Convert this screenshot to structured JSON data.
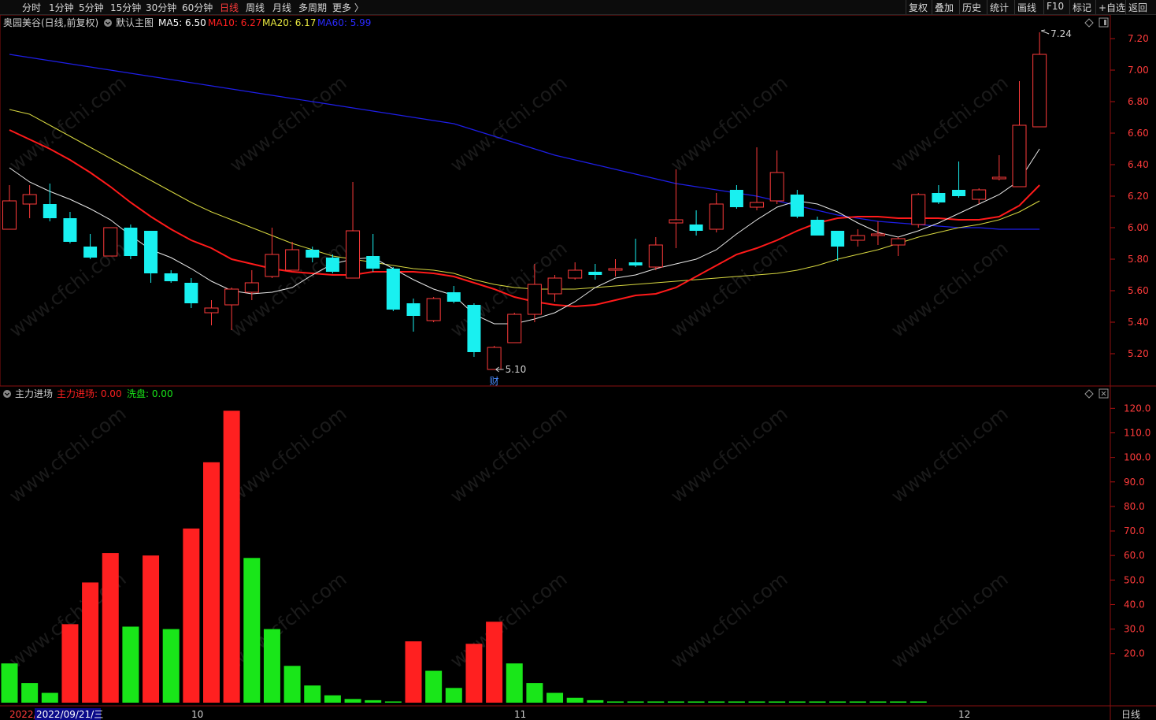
{
  "toolbar": {
    "periods": [
      "分时",
      "1分钟",
      "5分钟",
      "15分钟",
      "30分钟",
      "60分钟",
      "日线",
      "周线",
      "月线",
      "多周期",
      "更多 〉"
    ],
    "active_period": "日线",
    "right": [
      "复权",
      "叠加",
      "历史",
      "统计",
      "画线",
      "F10",
      "标记",
      "+自选",
      "返回"
    ]
  },
  "main_panel": {
    "stock_label": "奥园美谷(日线,前复权)",
    "template_label": "默认主图",
    "ma": [
      {
        "label": "MA5: 6.50",
        "color": "#ffffff"
      },
      {
        "label": "MA10: 6.27",
        "color": "#ff2020"
      },
      {
        "label": "MA20: 6.17",
        "color": "#e8e840"
      },
      {
        "label": "MA60: 5.99",
        "color": "#2a2aff"
      }
    ],
    "high_label": "7.24",
    "low_label": "5.10",
    "fin_marker": "财"
  },
  "sub_panel": {
    "title": "主力进场",
    "main_force_label": "主力进场: 0.00",
    "wash_label": "洗盘: 0.00",
    "main_force_color": "#ff2020",
    "wash_color": "#19e619"
  },
  "bottom_axis": {
    "first_date": "2022/",
    "cursor_date": "2022/09/21/三",
    "months": [
      "10",
      "11",
      "12"
    ],
    "period_label": "日线"
  },
  "chart_data": [
    {
      "type": "candlestick",
      "price_axis_ticks": [
        5.2,
        5.4,
        5.6,
        5.8,
        6.0,
        6.2,
        6.4,
        6.6,
        6.8,
        7.0,
        7.2
      ],
      "ylim": [
        5.0,
        7.3
      ],
      "candles": [
        {
          "o": 5.99,
          "h": 6.27,
          "l": 5.99,
          "c": 6.17
        },
        {
          "o": 6.15,
          "h": 6.27,
          "l": 6.06,
          "c": 6.21
        },
        {
          "o": 6.15,
          "h": 6.28,
          "l": 6.04,
          "c": 6.06
        },
        {
          "o": 6.06,
          "h": 6.1,
          "l": 5.9,
          "c": 5.91
        },
        {
          "o": 5.88,
          "h": 5.96,
          "l": 5.8,
          "c": 5.81
        },
        {
          "o": 5.82,
          "h": 6.0,
          "l": 5.82,
          "c": 6.0
        },
        {
          "o": 6.0,
          "h": 6.02,
          "l": 5.8,
          "c": 5.82
        },
        {
          "o": 5.98,
          "h": 5.98,
          "l": 5.65,
          "c": 5.71
        },
        {
          "o": 5.71,
          "h": 5.73,
          "l": 5.65,
          "c": 5.66
        },
        {
          "o": 5.65,
          "h": 5.68,
          "l": 5.49,
          "c": 5.52
        },
        {
          "o": 5.46,
          "h": 5.54,
          "l": 5.38,
          "c": 5.49
        },
        {
          "o": 5.51,
          "h": 5.62,
          "l": 5.35,
          "c": 5.61
        },
        {
          "o": 5.59,
          "h": 5.73,
          "l": 5.54,
          "c": 5.65
        },
        {
          "o": 5.69,
          "h": 6.0,
          "l": 5.68,
          "c": 5.83
        },
        {
          "o": 5.73,
          "h": 5.91,
          "l": 5.73,
          "c": 5.86
        },
        {
          "o": 5.86,
          "h": 5.88,
          "l": 5.78,
          "c": 5.81
        },
        {
          "o": 5.81,
          "h": 5.83,
          "l": 5.71,
          "c": 5.72
        },
        {
          "o": 5.68,
          "h": 6.29,
          "l": 5.68,
          "c": 5.98
        },
        {
          "o": 5.82,
          "h": 5.96,
          "l": 5.72,
          "c": 5.74
        },
        {
          "o": 5.74,
          "h": 5.75,
          "l": 5.47,
          "c": 5.48
        },
        {
          "o": 5.52,
          "h": 5.55,
          "l": 5.34,
          "c": 5.44
        },
        {
          "o": 5.41,
          "h": 5.56,
          "l": 5.4,
          "c": 5.55
        },
        {
          "o": 5.59,
          "h": 5.63,
          "l": 5.52,
          "c": 5.53
        },
        {
          "o": 5.51,
          "h": 5.52,
          "l": 5.18,
          "c": 5.21
        },
        {
          "o": 5.1,
          "h": 5.25,
          "l": 5.1,
          "c": 5.24
        },
        {
          "o": 5.27,
          "h": 5.46,
          "l": 5.27,
          "c": 5.45
        },
        {
          "o": 5.45,
          "h": 5.77,
          "l": 5.4,
          "c": 5.64
        },
        {
          "o": 5.58,
          "h": 5.7,
          "l": 5.53,
          "c": 5.68
        },
        {
          "o": 5.68,
          "h": 5.78,
          "l": 5.67,
          "c": 5.73
        },
        {
          "o": 5.72,
          "h": 5.77,
          "l": 5.67,
          "c": 5.7
        },
        {
          "o": 5.73,
          "h": 5.8,
          "l": 5.69,
          "c": 5.74
        },
        {
          "o": 5.78,
          "h": 5.93,
          "l": 5.75,
          "c": 5.76
        },
        {
          "o": 5.75,
          "h": 5.94,
          "l": 5.73,
          "c": 5.89
        },
        {
          "o": 6.03,
          "h": 6.37,
          "l": 5.87,
          "c": 6.05
        },
        {
          "o": 6.02,
          "h": 6.11,
          "l": 5.95,
          "c": 5.98
        },
        {
          "o": 5.99,
          "h": 6.22,
          "l": 5.97,
          "c": 6.15
        },
        {
          "o": 6.24,
          "h": 6.27,
          "l": 6.12,
          "c": 6.13
        },
        {
          "o": 6.13,
          "h": 6.51,
          "l": 6.11,
          "c": 6.16
        },
        {
          "o": 6.17,
          "h": 6.49,
          "l": 6.15,
          "c": 6.35
        },
        {
          "o": 6.21,
          "h": 6.24,
          "l": 6.06,
          "c": 6.07
        },
        {
          "o": 6.05,
          "h": 6.07,
          "l": 5.95,
          "c": 5.95
        },
        {
          "o": 5.98,
          "h": 5.98,
          "l": 5.79,
          "c": 5.88
        },
        {
          "o": 5.92,
          "h": 5.99,
          "l": 5.88,
          "c": 5.95
        },
        {
          "o": 5.95,
          "h": 6.04,
          "l": 5.89,
          "c": 5.96
        },
        {
          "o": 5.89,
          "h": 5.94,
          "l": 5.82,
          "c": 5.93
        },
        {
          "o": 6.02,
          "h": 6.22,
          "l": 6.0,
          "c": 6.21
        },
        {
          "o": 6.22,
          "h": 6.27,
          "l": 6.15,
          "c": 6.16
        },
        {
          "o": 6.24,
          "h": 6.42,
          "l": 6.19,
          "c": 6.2
        },
        {
          "o": 6.18,
          "h": 6.25,
          "l": 6.15,
          "c": 6.24
        },
        {
          "o": 6.31,
          "h": 6.46,
          "l": 6.3,
          "c": 6.32
        },
        {
          "o": 6.26,
          "h": 6.93,
          "l": 6.26,
          "c": 6.65
        },
        {
          "o": 6.64,
          "h": 7.24,
          "l": 6.64,
          "c": 7.1
        }
      ],
      "ma5": [
        6.38,
        6.29,
        6.23,
        6.18,
        6.12,
        6.05,
        5.95,
        5.86,
        5.81,
        5.74,
        5.66,
        5.6,
        5.58,
        5.59,
        5.62,
        5.7,
        5.77,
        5.8,
        5.81,
        5.74,
        5.67,
        5.61,
        5.57,
        5.45,
        5.39,
        5.39,
        5.42,
        5.46,
        5.53,
        5.62,
        5.68,
        5.7,
        5.74,
        5.77,
        5.8,
        5.86,
        5.96,
        6.05,
        6.13,
        6.17,
        6.15,
        6.1,
        6.03,
        5.97,
        5.94,
        5.98,
        6.03,
        6.09,
        6.15,
        6.21,
        6.3,
        6.5
      ],
      "ma10": [
        6.62,
        6.56,
        6.5,
        6.43,
        6.35,
        6.26,
        6.16,
        6.07,
        5.99,
        5.92,
        5.87,
        5.8,
        5.77,
        5.74,
        5.72,
        5.71,
        5.7,
        5.7,
        5.72,
        5.72,
        5.72,
        5.71,
        5.69,
        5.65,
        5.61,
        5.56,
        5.53,
        5.51,
        5.5,
        5.51,
        5.54,
        5.57,
        5.58,
        5.62,
        5.69,
        5.76,
        5.83,
        5.87,
        5.92,
        5.98,
        6.03,
        6.06,
        6.07,
        6.07,
        6.06,
        6.06,
        6.06,
        6.05,
        6.05,
        6.07,
        6.14,
        6.27
      ],
      "ma20": [
        6.75,
        6.72,
        6.65,
        6.58,
        6.51,
        6.44,
        6.37,
        6.3,
        6.23,
        6.16,
        6.1,
        6.05,
        6.0,
        5.95,
        5.9,
        5.86,
        5.82,
        5.8,
        5.78,
        5.76,
        5.74,
        5.73,
        5.71,
        5.67,
        5.64,
        5.62,
        5.61,
        5.61,
        5.61,
        5.62,
        5.63,
        5.64,
        5.65,
        5.66,
        5.67,
        5.68,
        5.69,
        5.7,
        5.71,
        5.73,
        5.76,
        5.8,
        5.83,
        5.86,
        5.9,
        5.94,
        5.97,
        6.0,
        6.02,
        6.05,
        6.1,
        6.17
      ],
      "ma60": [
        7.1,
        7.08,
        7.06,
        7.04,
        7.02,
        7.0,
        6.98,
        6.96,
        6.94,
        6.92,
        6.9,
        6.88,
        6.86,
        6.84,
        6.82,
        6.8,
        6.78,
        6.76,
        6.74,
        6.72,
        6.7,
        6.68,
        6.66,
        6.62,
        6.58,
        6.54,
        6.5,
        6.46,
        6.43,
        6.4,
        6.37,
        6.34,
        6.31,
        6.28,
        6.26,
        6.24,
        6.22,
        6.2,
        6.17,
        6.14,
        6.11,
        6.08,
        6.06,
        6.04,
        6.03,
        6.02,
        6.01,
        6.0,
        6.0,
        5.99,
        5.99,
        5.99
      ]
    },
    {
      "type": "bar",
      "title": "主力进场",
      "value_axis_ticks": [
        20,
        30,
        40,
        50,
        60,
        70,
        80,
        90,
        100,
        110,
        120
      ],
      "ylim": [
        0,
        123
      ],
      "series": [
        {
          "name": "主力进场",
          "color": "#ff2020",
          "values": [
            0,
            0,
            0,
            32,
            49,
            61,
            0,
            60,
            0,
            71,
            98,
            119,
            0,
            0,
            0,
            0,
            0,
            0,
            0,
            0,
            25,
            0,
            0,
            24,
            33,
            0,
            0,
            0,
            0,
            0,
            0,
            0,
            0,
            0,
            0,
            0,
            0,
            0,
            0,
            0,
            0,
            0,
            0,
            0,
            0,
            0,
            0,
            0,
            0,
            0,
            0,
            0
          ]
        },
        {
          "name": "洗盘",
          "color": "#19e619",
          "values": [
            16,
            8,
            4,
            0,
            0,
            0,
            31,
            0,
            30,
            0,
            0,
            0,
            59,
            30,
            15,
            7,
            3,
            1.5,
            1,
            0.5,
            0,
            13,
            6,
            0,
            0,
            16,
            8,
            4,
            2,
            1,
            0.5,
            0.5,
            0.5,
            0.5,
            0.5,
            0.5,
            0.5,
            0.5,
            0.5,
            0.5,
            0.5,
            0.5,
            0.5,
            0.5,
            0.5,
            0.5,
            0,
            0,
            0,
            0,
            0,
            0
          ]
        }
      ]
    }
  ]
}
